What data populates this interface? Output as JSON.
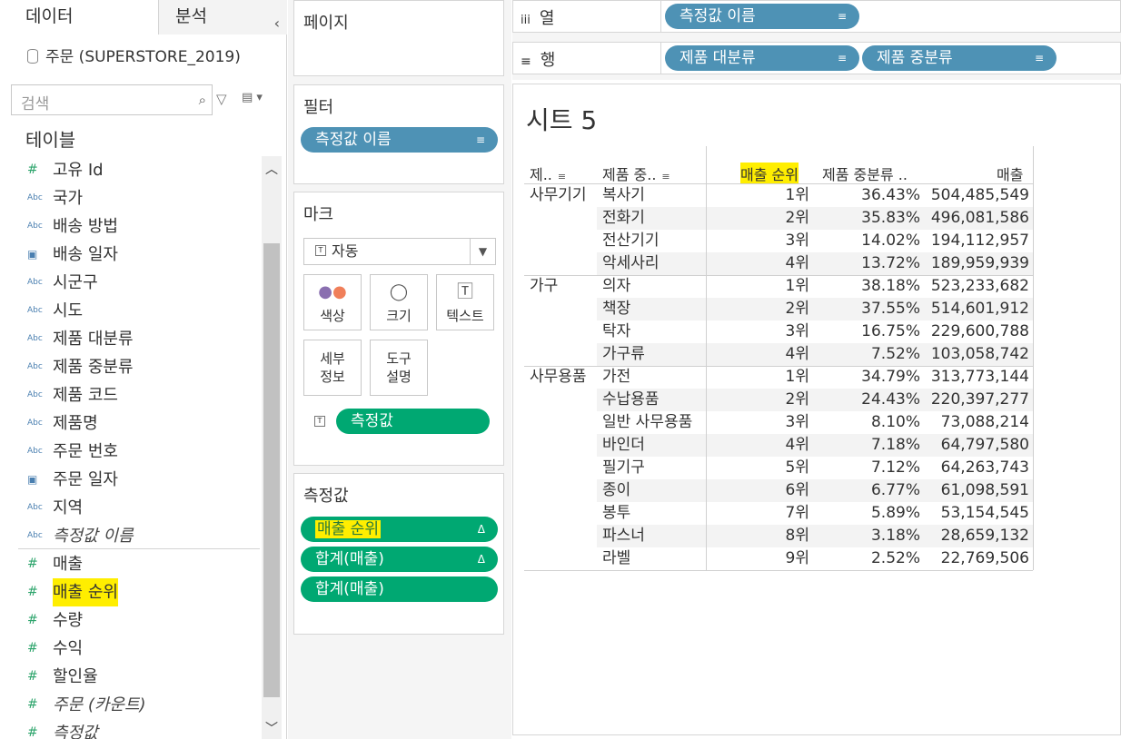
{
  "data_pane": {
    "tab_data": "데이터",
    "tab_analysis": "분석",
    "collapse": "‹",
    "datasource": "주문 (SUPERSTORE_2019)",
    "search_placeholder": "검색",
    "tables_label": "테이블",
    "fields": [
      {
        "icon": "Abc",
        "type": "num",
        "label": "고유 Id"
      },
      {
        "icon": "Abc",
        "type": "str",
        "label": "국가"
      },
      {
        "icon": "Abc",
        "type": "str",
        "label": "배송 방법"
      },
      {
        "icon": "date",
        "type": "date",
        "label": "배송 일자"
      },
      {
        "icon": "Abc",
        "type": "str",
        "label": "시군구"
      },
      {
        "icon": "Abc",
        "type": "str",
        "label": "시도"
      },
      {
        "icon": "Abc",
        "type": "str",
        "label": "제품 대분류"
      },
      {
        "icon": "Abc",
        "type": "str",
        "label": "제품 중분류"
      },
      {
        "icon": "Abc",
        "type": "str",
        "label": "제품 코드"
      },
      {
        "icon": "Abc",
        "type": "str",
        "label": "제품명"
      },
      {
        "icon": "Abc",
        "type": "str",
        "label": "주문 번호"
      },
      {
        "icon": "date",
        "type": "date",
        "label": "주문 일자"
      },
      {
        "icon": "Abc",
        "type": "str",
        "label": "지역"
      },
      {
        "icon": "Abc",
        "type": "str",
        "label": "측정값 이름"
      },
      {
        "icon": "#",
        "type": "num",
        "label": "매출"
      },
      {
        "icon": "#",
        "type": "num",
        "label": "매출 순위"
      },
      {
        "icon": "#",
        "type": "num",
        "label": "수량"
      },
      {
        "icon": "#",
        "type": "num",
        "label": "수익"
      },
      {
        "icon": "#",
        "type": "num",
        "label": "할인율"
      },
      {
        "icon": "#",
        "type": "num",
        "label": "주문 (카운트)"
      },
      {
        "icon": "#",
        "type": "num",
        "label": "측정값"
      }
    ]
  },
  "cards": {
    "pages_title": "페이지",
    "filters_title": "필터",
    "filter_pill": "측정값 이름",
    "marks_title": "마크",
    "mark_type": "자동",
    "mark_color": "색상",
    "mark_size": "크기",
    "mark_text": "텍스트",
    "mark_detail": "세부\n정보",
    "mark_tooltip": "도구\n설명",
    "mark_pill": "측정값",
    "measures_title": "측정값",
    "measure_pills": [
      "매출 순위",
      "합계(매출)",
      "합계(매출)"
    ],
    "delta": "Δ"
  },
  "shelves": {
    "columns_label": "열",
    "rows_label": "행",
    "columns_pill": "측정값 이름",
    "rows_pills": [
      "제품 대분류",
      "제품 중분류"
    ]
  },
  "view": {
    "sheet_title": "시트 5",
    "headers": [
      "제..",
      "제품 중..",
      "매출 순위",
      "제품 중분류 ..",
      "매출"
    ],
    "groups": [
      {
        "category": "사무기기",
        "rows": [
          [
            "복사기",
            "1위",
            "36.43%",
            "504,485,549"
          ],
          [
            "전화기",
            "2위",
            "35.83%",
            "496,081,586"
          ],
          [
            "전산기기",
            "3위",
            "14.02%",
            "194,112,957"
          ],
          [
            "악세사리",
            "4위",
            "13.72%",
            "189,959,939"
          ]
        ]
      },
      {
        "category": "가구",
        "rows": [
          [
            "의자",
            "1위",
            "38.18%",
            "523,233,682"
          ],
          [
            "책장",
            "2위",
            "37.55%",
            "514,601,912"
          ],
          [
            "탁자",
            "3위",
            "16.75%",
            "229,600,788"
          ],
          [
            "가구류",
            "4위",
            "7.52%",
            "103,058,742"
          ]
        ]
      },
      {
        "category": "사무용품",
        "rows": [
          [
            "가전",
            "1위",
            "34.79%",
            "313,773,144"
          ],
          [
            "수납용품",
            "2위",
            "24.43%",
            "220,397,277"
          ],
          [
            "일반 사무용품",
            "3위",
            "8.10%",
            "73,088,214"
          ],
          [
            "바인더",
            "4위",
            "7.18%",
            "64,797,580"
          ],
          [
            "필기구",
            "5위",
            "7.12%",
            "64,263,743"
          ],
          [
            "종이",
            "6위",
            "6.77%",
            "61,098,591"
          ],
          [
            "봉투",
            "7위",
            "5.89%",
            "53,154,545"
          ],
          [
            "파스너",
            "8위",
            "3.18%",
            "28,659,132"
          ],
          [
            "라벨",
            "9위",
            "2.52%",
            "22,769,506"
          ]
        ]
      }
    ]
  },
  "colors": {
    "pill_blue": "#4e92b5",
    "pill_green": "#00a872",
    "highlight": "#ffee00"
  }
}
